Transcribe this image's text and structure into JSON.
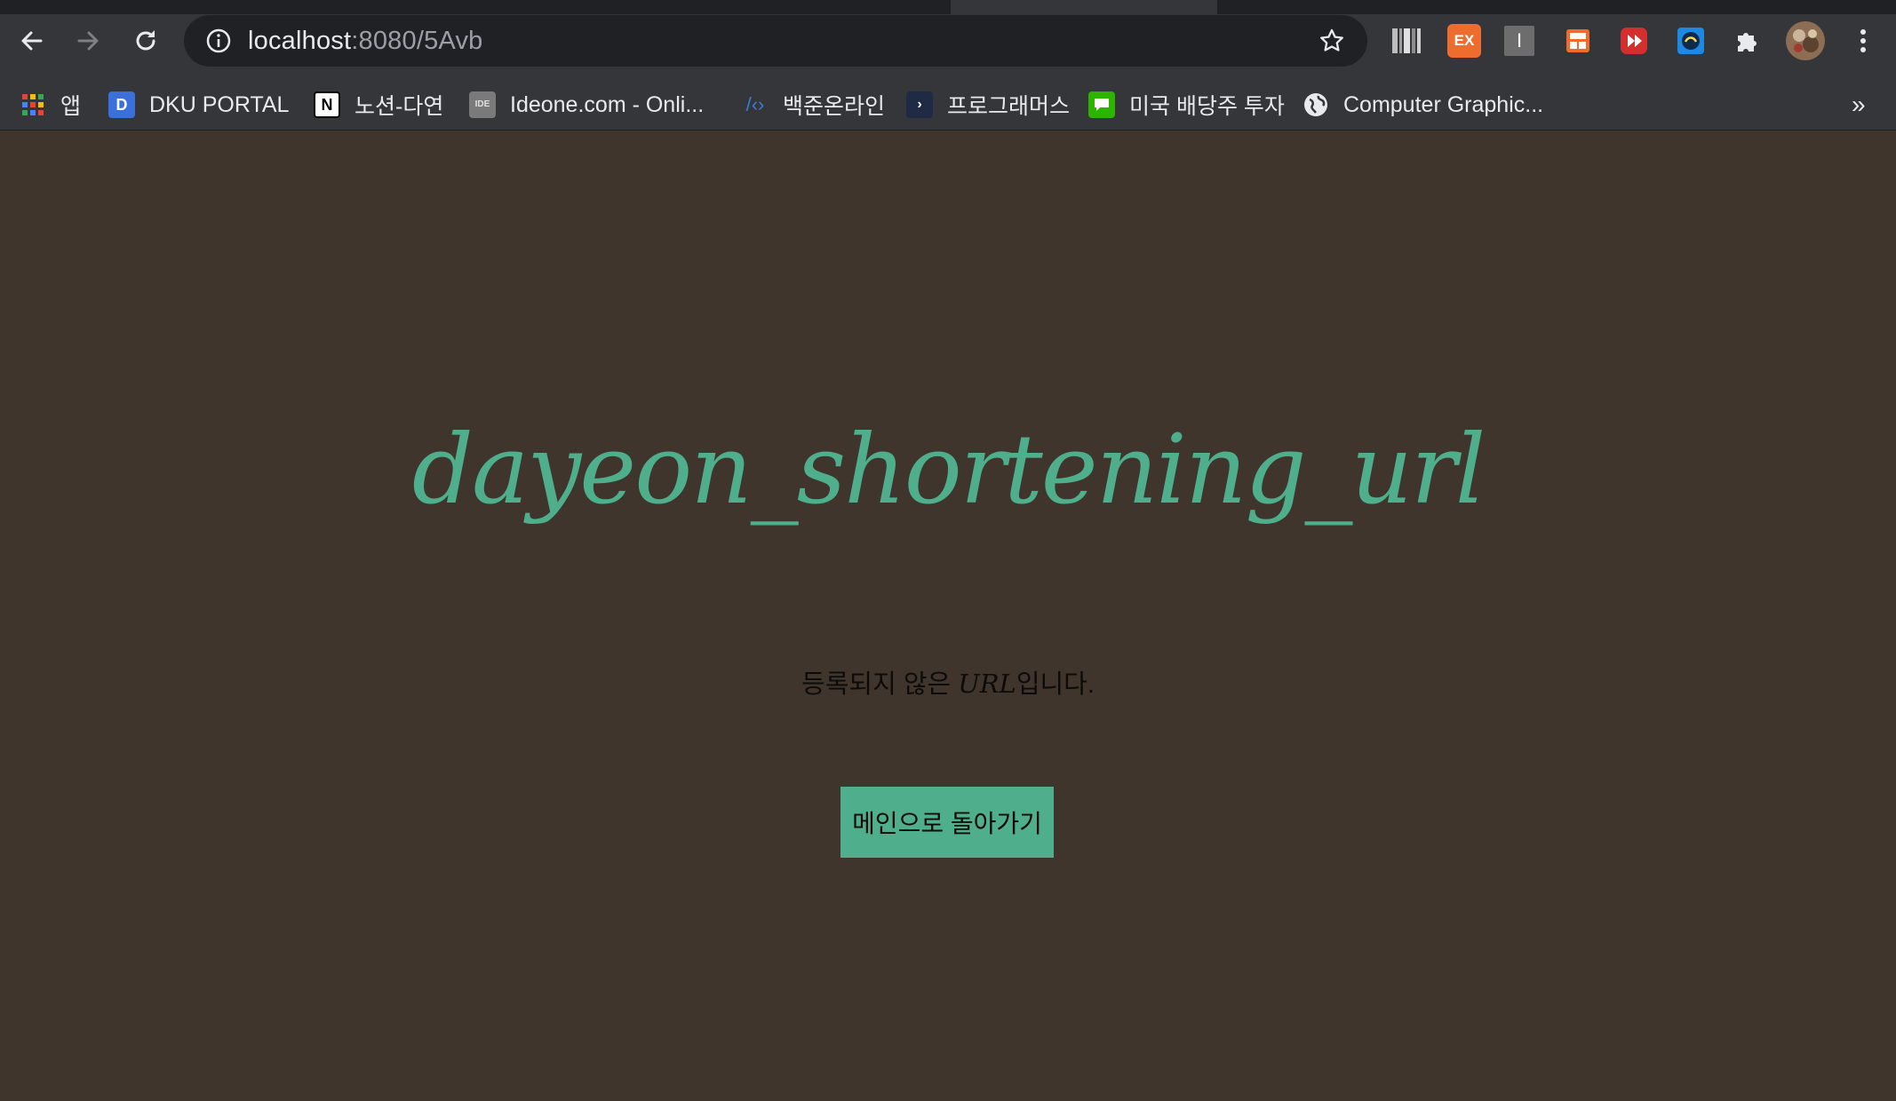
{
  "browser": {
    "address_host": "localhost",
    "address_path": ":8080/5Avb",
    "bookmarks": [
      {
        "label": "앱",
        "icon": "apps-grid-icon"
      },
      {
        "label": "DKU PORTAL",
        "icon": "dku-portal-icon"
      },
      {
        "label": "노션-다연",
        "icon": "notion-icon"
      },
      {
        "label": "Ideone.com - Onli...",
        "icon": "ideone-icon"
      },
      {
        "label": "백준온라인",
        "icon": "baekjoon-icon"
      },
      {
        "label": "프로그래머스",
        "icon": "programmers-icon"
      },
      {
        "label": "미국 배당주 투자",
        "icon": "chat-bubble-icon"
      },
      {
        "label": "Computer Graphic...",
        "icon": "globe-icon"
      }
    ],
    "bookmarks_overflow": "»",
    "extensions": [
      "barcode-extension-icon",
      "ex-extension-icon",
      "i-extension-icon",
      "layout-extension-icon",
      "red-extension-icon",
      "blue-extension-icon",
      "puzzle-icon",
      "profile-avatar",
      "menu-dots-icon"
    ],
    "ext_ex_label": "EX",
    "ext_i_label": "I"
  },
  "page": {
    "title": "dayeon_shortening_url",
    "message_prefix": "등록되지 않은 ",
    "message_url": "URL",
    "message_suffix": "입니다.",
    "main_button_label": "메인으로 돌아가기"
  },
  "colors": {
    "background": "#3f352d",
    "accent": "#4fae8b",
    "toolbar": "#35363a"
  }
}
